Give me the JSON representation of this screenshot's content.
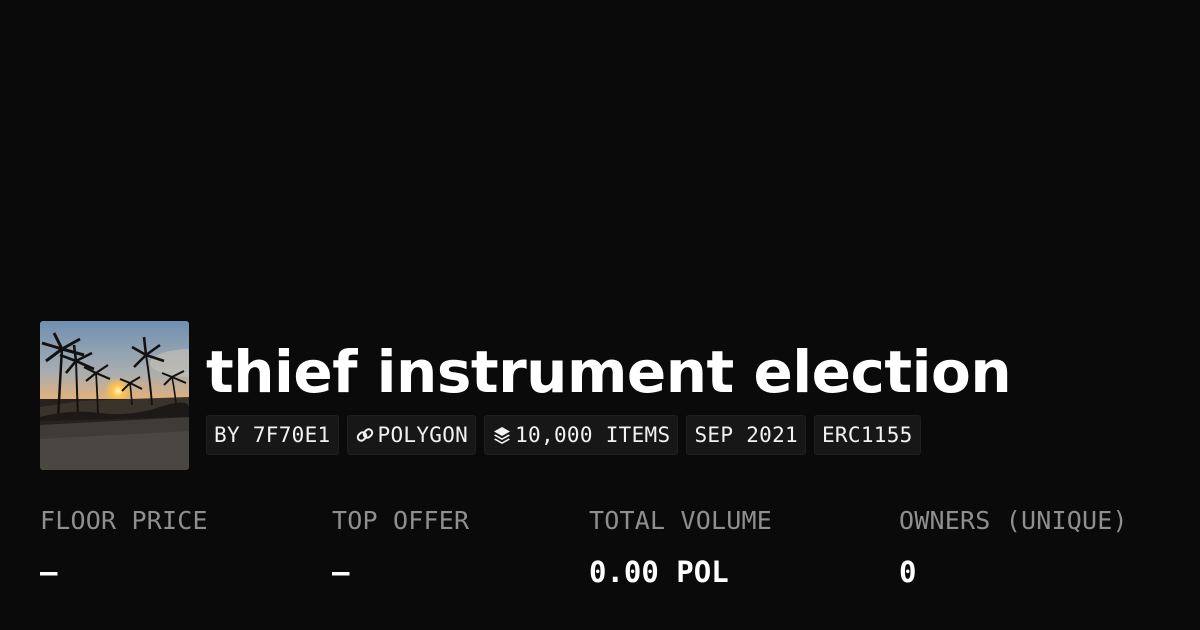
{
  "collection": {
    "title": "thief instrument election",
    "thumbnail_icon": "sunset-palm-trees-image"
  },
  "tags": {
    "creator": "BY 7F70E1",
    "chain": "POLYGON",
    "chain_icon": "chain-link-icon",
    "items": "10,000 ITEMS",
    "items_icon": "layers-icon",
    "date": "SEP 2021",
    "standard": "ERC1155"
  },
  "stats": {
    "floor_price": {
      "label": "FLOOR PRICE",
      "value": "–"
    },
    "top_offer": {
      "label": "TOP OFFER",
      "value": "–"
    },
    "total_volume": {
      "label": "TOTAL VOLUME",
      "value": "0.00 POL"
    },
    "owners": {
      "label": "OWNERS (UNIQUE)",
      "value": "0"
    }
  },
  "colors": {
    "background": "#0a0a0a",
    "tag_background": "#171717",
    "label_gray": "#8f8f8f",
    "text_white": "#ffffff"
  }
}
